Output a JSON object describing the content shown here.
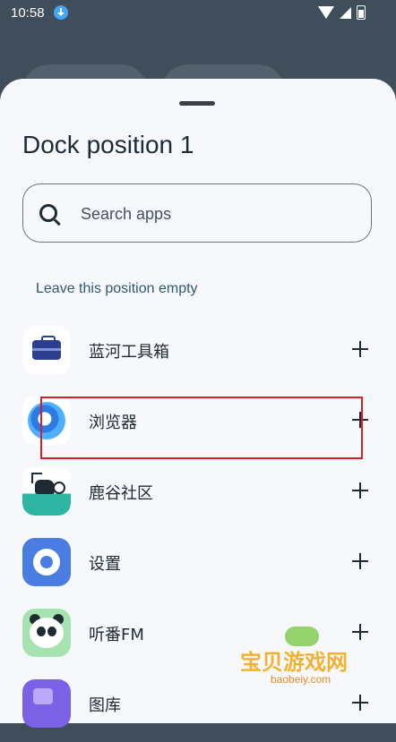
{
  "status_bar": {
    "time": "10:58"
  },
  "sheet": {
    "title": "Dock position 1",
    "search": {
      "placeholder": "Search apps",
      "value": ""
    },
    "empty_option": "Leave this position empty",
    "apps": [
      {
        "name": "蓝河工具箱",
        "icon": "toolbox-icon"
      },
      {
        "name": "浏览器",
        "icon": "browser-icon"
      },
      {
        "name": "鹿谷社区",
        "icon": "deer-community-icon"
      },
      {
        "name": "设置",
        "icon": "settings-gear-icon"
      },
      {
        "name": "听番FM",
        "icon": "panda-icon"
      },
      {
        "name": "图库",
        "icon": "gallery-icon"
      }
    ]
  },
  "watermark": {
    "text": "宝贝游戏网",
    "url": "baobeiy.com"
  },
  "colors": {
    "sheet_bg": "#f6f8fb",
    "highlight": "#d61f2b",
    "backdrop": "#3f4e5a"
  }
}
